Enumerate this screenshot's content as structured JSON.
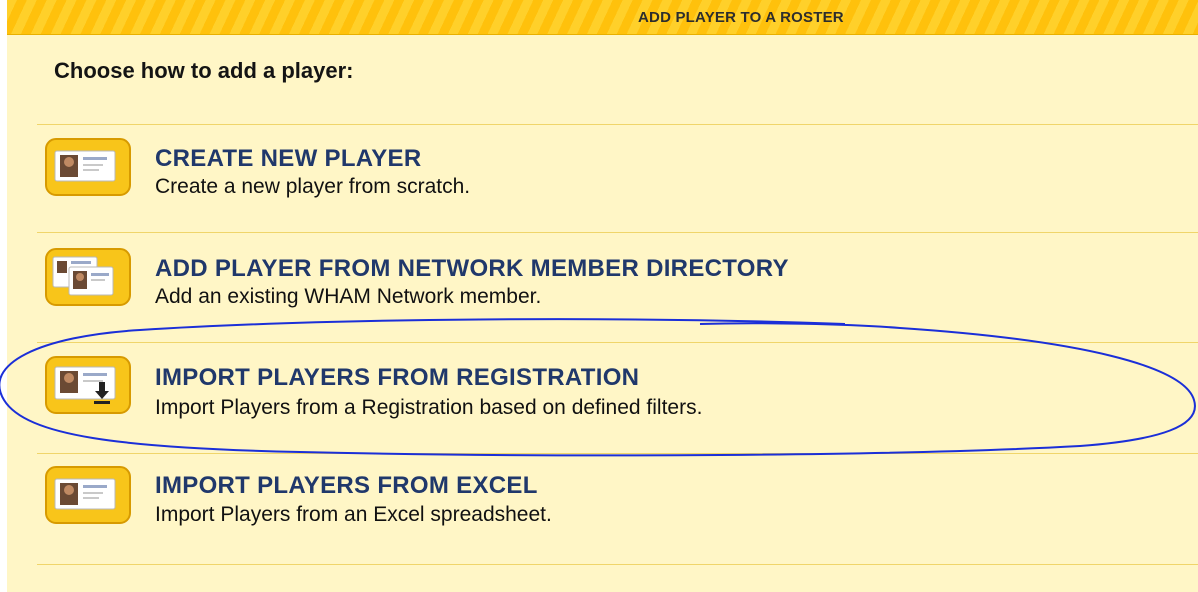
{
  "header": {
    "title": "ADD PLAYER TO A ROSTER"
  },
  "prompt": "Choose how to add a player:",
  "options": [
    {
      "title": "CREATE NEW PLAYER",
      "description": "Create a new player from scratch.",
      "icon": "player-card-icon"
    },
    {
      "title": "ADD PLAYER FROM NETWORK MEMBER DIRECTORY",
      "description": "Add an existing WHAM Network member.",
      "icon": "directory-cards-icon"
    },
    {
      "title": "IMPORT PLAYERS FROM REGISTRATION",
      "description": "Import Players from a Registration based on defined filters.",
      "icon": "player-card-download-icon"
    },
    {
      "title": "IMPORT PLAYERS FROM EXCEL",
      "description": "Import Players from an Excel spreadsheet.",
      "icon": "player-card-icon"
    }
  ],
  "colors": {
    "header": "#ffc10c",
    "panel": "#fff6c6",
    "title": "#20386b",
    "annotation": "#1b2fd8"
  }
}
